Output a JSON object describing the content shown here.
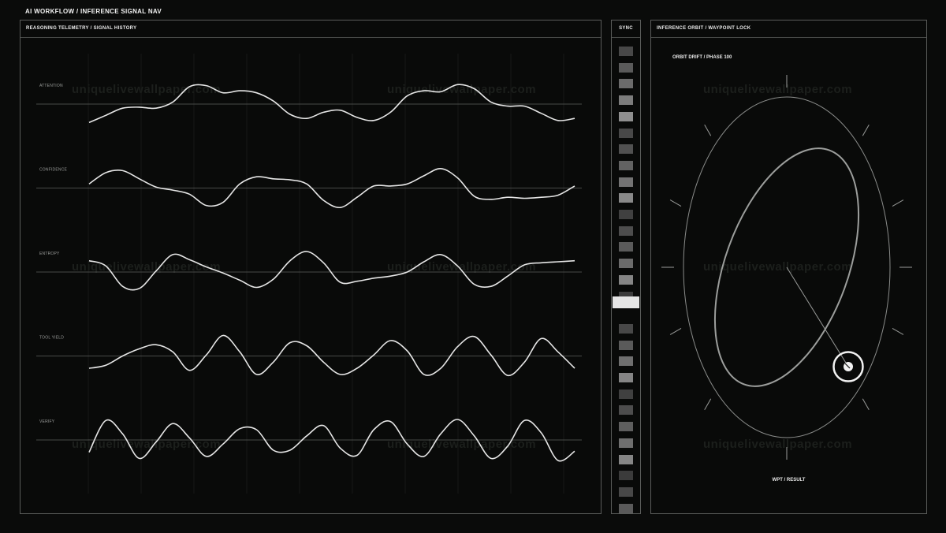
{
  "app": {
    "title": "AI WORKFLOW / INFERENCE SIGNAL NAV"
  },
  "telemetry": {
    "title": "REASONING TELEMETRY / SIGNAL HISTORY",
    "signals": [
      {
        "label": "ATTENTION",
        "samples": [
          -0.9,
          -0.55,
          -0.2,
          -0.15,
          -0.2,
          0.1,
          0.85,
          0.9,
          0.55,
          0.65,
          0.55,
          0.15,
          -0.5,
          -0.7,
          -0.4,
          -0.3,
          -0.65,
          -0.8,
          -0.4,
          0.4,
          0.65,
          0.6,
          0.95,
          0.75,
          0.1,
          -0.1,
          -0.1,
          -0.45,
          -0.8,
          -0.7
        ]
      },
      {
        "label": "CONFIDENCE",
        "samples": [
          0.2,
          0.75,
          0.85,
          0.45,
          0.05,
          -0.1,
          -0.3,
          -0.85,
          -0.7,
          0.2,
          0.55,
          0.45,
          0.4,
          0.2,
          -0.6,
          -0.95,
          -0.45,
          0.1,
          0.1,
          0.2,
          0.6,
          0.95,
          0.5,
          -0.4,
          -0.55,
          -0.45,
          -0.5,
          -0.45,
          -0.35,
          0.1
        ]
      },
      {
        "label": "ENTROPY",
        "samples": [
          0.55,
          0.3,
          -0.7,
          -0.8,
          0.05,
          0.85,
          0.6,
          0.25,
          -0.05,
          -0.4,
          -0.75,
          -0.35,
          0.55,
          1.0,
          0.45,
          -0.5,
          -0.45,
          -0.3,
          -0.2,
          0.0,
          0.5,
          0.85,
          0.3,
          -0.6,
          -0.7,
          -0.2,
          0.35,
          0.45,
          0.5,
          0.55
        ]
      },
      {
        "label": "TOOL YIELD",
        "samples": [
          -0.6,
          -0.45,
          0.0,
          0.35,
          0.55,
          0.2,
          -0.7,
          0.05,
          1.0,
          0.2,
          -0.9,
          -0.3,
          0.65,
          0.5,
          -0.3,
          -0.9,
          -0.6,
          0.05,
          0.75,
          0.25,
          -0.9,
          -0.6,
          0.45,
          0.95,
          0.05,
          -0.95,
          -0.3,
          0.85,
          0.2,
          -0.6
        ]
      },
      {
        "label": "VERIFY",
        "samples": [
          -0.6,
          0.95,
          0.3,
          -0.9,
          -0.1,
          0.8,
          0.1,
          -0.8,
          -0.2,
          0.55,
          0.5,
          -0.5,
          -0.5,
          0.2,
          0.7,
          -0.4,
          -0.75,
          0.5,
          0.9,
          -0.2,
          -0.8,
          0.3,
          1.0,
          0.2,
          -0.9,
          -0.3,
          0.95,
          0.35,
          -1.0,
          -0.55
        ]
      }
    ]
  },
  "watermark": "uniquelivewallpaper.com",
  "sync": {
    "title": "SYNC",
    "cells": [
      0.22,
      0.3,
      0.38,
      0.46,
      0.55,
      0.22,
      0.26,
      0.34,
      0.42,
      0.52,
      0.18,
      0.24,
      0.3,
      0.38,
      0.5,
      0.16,
      0.95,
      0.22,
      0.3,
      0.4,
      0.5,
      0.18,
      0.24,
      0.32,
      0.4,
      0.5,
      0.16,
      0.22,
      0.3
    ],
    "active_index": 16
  },
  "orbit": {
    "title": "INFERENCE ORBIT / WAYPOINT LOCK",
    "drift_label": "ORBIT DRIFT / PHASE 100",
    "result_label": "WPT / RESULT"
  },
  "colors": {
    "background": "#0a0b0a",
    "panel_border": "#5a5c5a",
    "trace": "#e6e6e6",
    "baseline": "#5e605e"
  }
}
